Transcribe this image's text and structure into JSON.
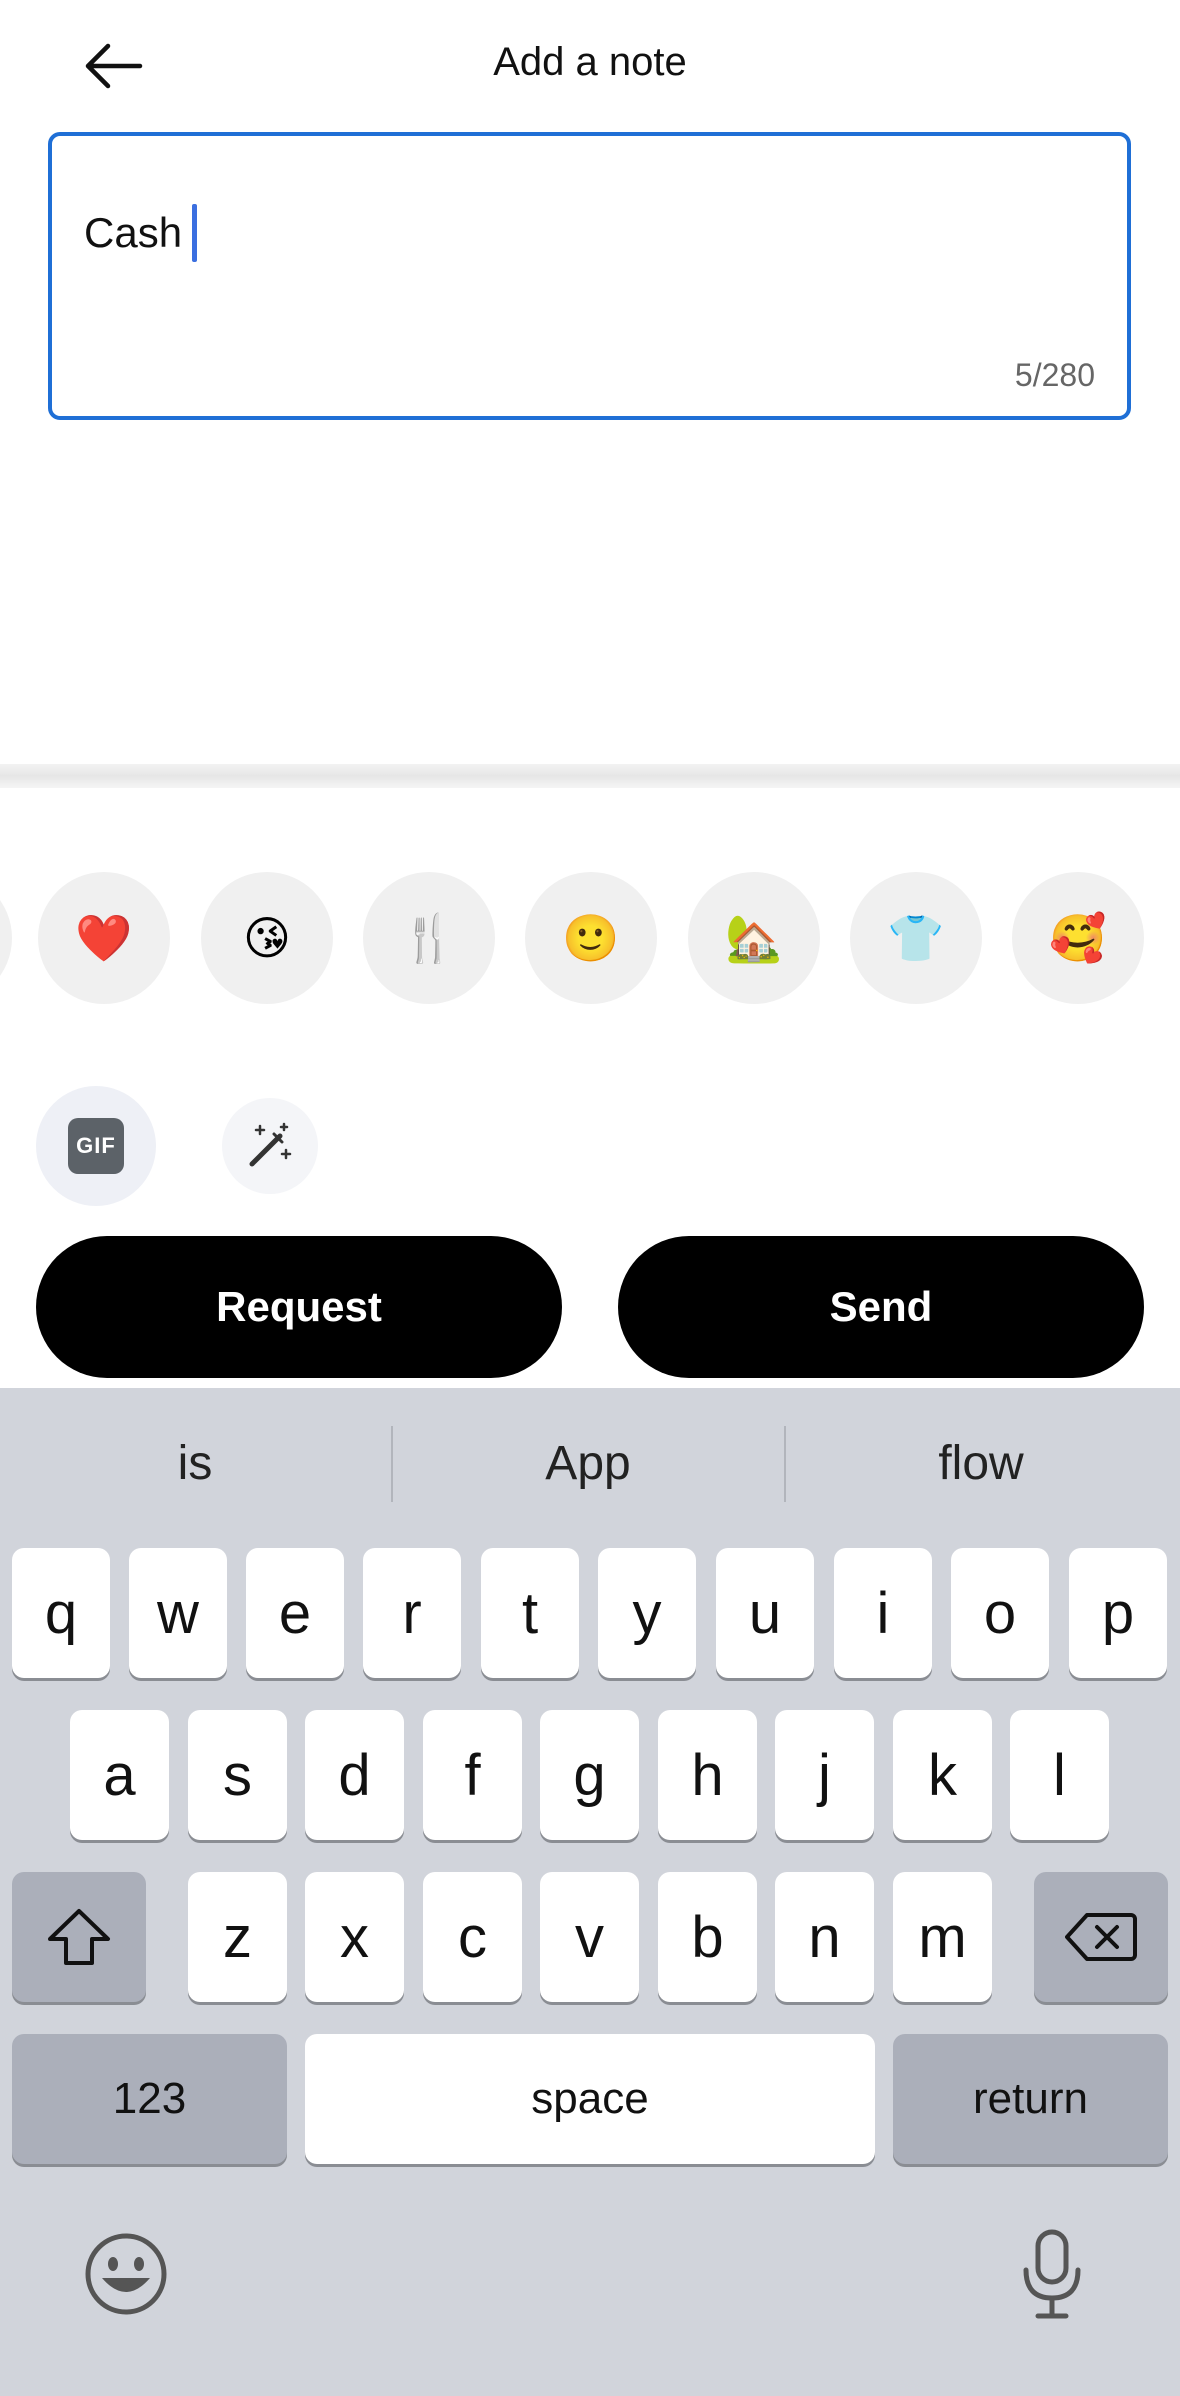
{
  "header": {
    "title": "Add a note"
  },
  "note": {
    "value": "Cash",
    "counter": "5/280"
  },
  "emojis": [
    "❤️",
    "😘",
    "🍴",
    "🙂",
    "🏡",
    "👕",
    "🥰"
  ],
  "tools": {
    "gif_label": "GIF"
  },
  "actions": {
    "request_label": "Request",
    "send_label": "Send"
  },
  "keyboard": {
    "suggestions": [
      "is",
      "App",
      "flow"
    ],
    "row1": [
      "q",
      "w",
      "e",
      "r",
      "t",
      "y",
      "u",
      "i",
      "o",
      "p"
    ],
    "row2": [
      "a",
      "s",
      "d",
      "f",
      "g",
      "h",
      "j",
      "k",
      "l"
    ],
    "row3": [
      "z",
      "x",
      "c",
      "v",
      "b",
      "n",
      "m"
    ],
    "numbers_label": "123",
    "space_label": "space",
    "return_label": "return"
  },
  "icons": {
    "back": "arrow-left-icon",
    "magic": "magic-wand-icon",
    "shift": "shift-icon",
    "delete": "backspace-icon",
    "emoji": "emoji-icon",
    "mic": "microphone-icon"
  }
}
